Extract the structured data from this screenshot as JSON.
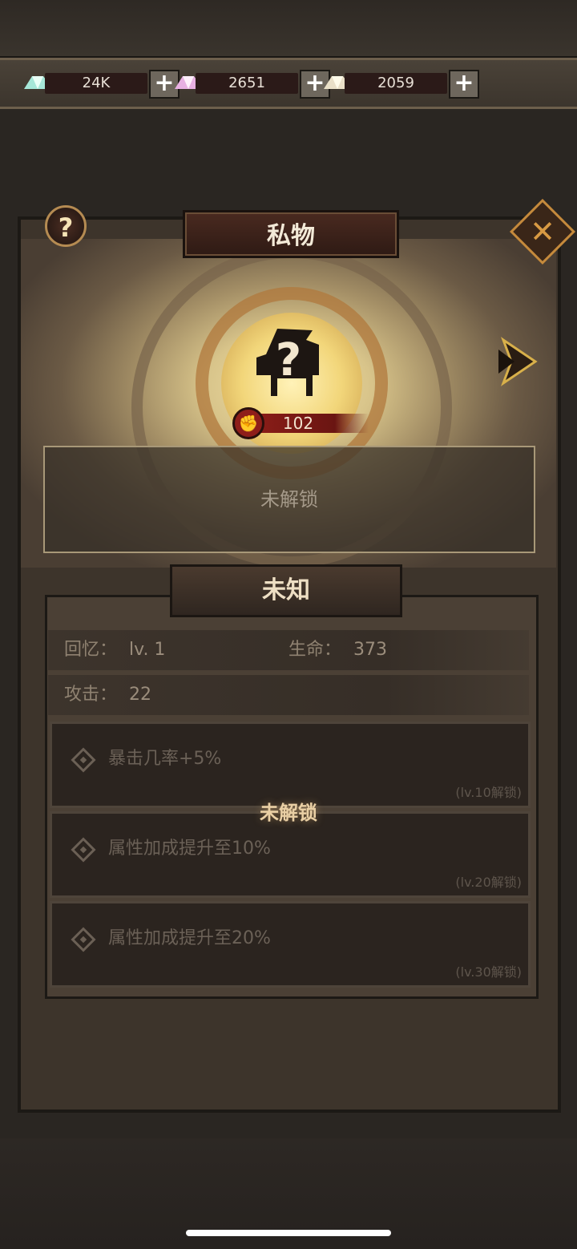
{
  "resources": [
    {
      "icon": "crystal-teal-icon",
      "value": "24K"
    },
    {
      "icon": "crystal-pink-icon",
      "value": "2651"
    },
    {
      "icon": "crystal-white-icon",
      "value": "2059"
    }
  ],
  "plus_symbol": "+",
  "panel": {
    "title": "私物",
    "help_symbol": "?",
    "close_symbol": "✕",
    "power": "102",
    "power_icon": "✊",
    "locked_text": "未解锁",
    "item_name": "未知"
  },
  "stats": {
    "memory_label": "回忆：",
    "memory_value": "lv. 1",
    "hp_label": "生命：",
    "hp_value": "373",
    "attack_label": "攻击：",
    "attack_value": "22"
  },
  "skills": [
    {
      "desc": "暴击几率+5%",
      "req": "(lv.10解锁)"
    },
    {
      "desc": "属性加成提升至10%",
      "req": "(lv.20解锁)"
    },
    {
      "desc": "属性加成提升至20%",
      "req": "(lv.30解锁)"
    }
  ],
  "skills_unlock_label": "未解锁",
  "colors": {
    "accent_gold": "#c58a3c",
    "power_red": "#8a1d18",
    "panel_bg": "#3d342b"
  }
}
